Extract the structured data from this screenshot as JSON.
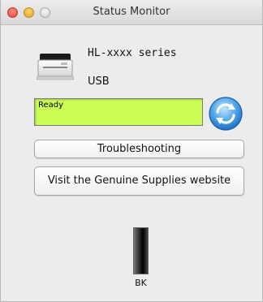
{
  "window": {
    "title": "Status Monitor"
  },
  "device": {
    "model": "HL-xxxx series",
    "connection": "USB",
    "icon": "printer-icon"
  },
  "status": {
    "text": "Ready",
    "color": "#ccff55"
  },
  "buttons": {
    "refresh_icon": "refresh-icon",
    "troubleshooting_label": "Troubleshooting",
    "supplies_label": "Visit the Genuine Supplies website"
  },
  "ink": {
    "label": "BK",
    "level": 1.0,
    "color": "#000000"
  }
}
